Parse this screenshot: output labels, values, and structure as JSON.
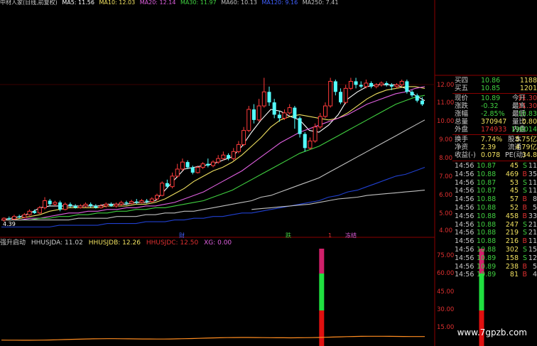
{
  "top_bar": {
    "title": "中材人家(日线,前复权)",
    "ma": [
      {
        "label": "MA5: 11.56",
        "color": "#ffffff"
      },
      {
        "label": "MA10: 12.03",
        "color": "#f0e060"
      },
      {
        "label": "MA20: 12.14",
        "color": "#e060e0"
      },
      {
        "label": "MA30: 11.97",
        "color": "#40d040"
      },
      {
        "label": "MA60: 10.13",
        "color": "#c0c0c0"
      },
      {
        "label": "MA120: 9.16",
        "color": "#4060ff"
      },
      {
        "label": "MA250: 7.41",
        "color": "#c0c0c0"
      }
    ]
  },
  "price_axis": {
    "ticks": [
      "12.00",
      "11.00",
      "10.00",
      "9.00",
      "8.00",
      "7.00",
      "6.00",
      "5.00",
      "4.00"
    ],
    "low_label": "4.39"
  },
  "chart_data": {
    "type": "candlestick",
    "ylim": [
      3.8,
      12.3
    ],
    "candles": [
      [
        4.3,
        4.4,
        4.2,
        4.45
      ],
      [
        4.4,
        4.35,
        4.3,
        4.5
      ],
      [
        4.35,
        4.5,
        4.3,
        4.6
      ],
      [
        4.5,
        4.45,
        4.4,
        4.6
      ],
      [
        4.45,
        4.6,
        4.4,
        4.7
      ],
      [
        4.6,
        4.8,
        4.55,
        4.9
      ],
      [
        4.8,
        4.7,
        4.65,
        4.9
      ],
      [
        4.7,
        5.0,
        4.65,
        5.1
      ],
      [
        5.0,
        5.4,
        4.9,
        5.6
      ],
      [
        5.4,
        5.2,
        5.1,
        5.5
      ],
      [
        5.2,
        5.3,
        5.1,
        5.4
      ],
      [
        5.3,
        4.9,
        4.8,
        5.4
      ],
      [
        4.9,
        5.2,
        4.85,
        5.3
      ],
      [
        5.2,
        5.1,
        5.0,
        5.3
      ],
      [
        5.1,
        5.0,
        4.95,
        5.2
      ],
      [
        5.0,
        5.1,
        4.95,
        5.2
      ],
      [
        5.1,
        5.2,
        5.0,
        5.3
      ],
      [
        5.2,
        5.1,
        5.0,
        5.3
      ],
      [
        5.1,
        5.0,
        4.95,
        5.2
      ],
      [
        5.0,
        5.1,
        4.95,
        5.2
      ],
      [
        5.1,
        5.2,
        5.0,
        5.3
      ],
      [
        5.2,
        5.1,
        5.05,
        5.3
      ],
      [
        5.1,
        5.2,
        5.0,
        5.3
      ],
      [
        5.2,
        5.3,
        5.1,
        5.4
      ],
      [
        5.3,
        5.25,
        5.15,
        5.4
      ],
      [
        5.25,
        5.35,
        5.2,
        5.45
      ],
      [
        5.35,
        5.3,
        5.2,
        5.5
      ],
      [
        5.3,
        5.4,
        5.25,
        5.5
      ],
      [
        5.4,
        5.35,
        5.25,
        5.5
      ],
      [
        5.35,
        5.5,
        5.3,
        5.6
      ],
      [
        5.5,
        5.7,
        5.4,
        5.8
      ],
      [
        5.7,
        6.4,
        5.65,
        6.5
      ],
      [
        6.4,
        6.2,
        6.1,
        6.6
      ],
      [
        6.2,
        6.8,
        6.1,
        7.0
      ],
      [
        6.8,
        7.2,
        6.7,
        7.5
      ],
      [
        7.2,
        7.6,
        7.1,
        7.8
      ],
      [
        7.6,
        7.3,
        7.2,
        7.7
      ],
      [
        7.3,
        7.0,
        6.9,
        7.4
      ],
      [
        7.0,
        7.3,
        6.95,
        7.4
      ],
      [
        7.3,
        7.5,
        7.2,
        7.6
      ],
      [
        7.5,
        7.4,
        7.3,
        7.8
      ],
      [
        7.4,
        7.6,
        7.3,
        7.7
      ],
      [
        7.6,
        7.8,
        7.5,
        8.0
      ],
      [
        7.8,
        8.0,
        7.7,
        8.2
      ],
      [
        8.0,
        7.8,
        7.7,
        8.1
      ],
      [
        7.8,
        8.2,
        7.7,
        8.4
      ],
      [
        8.2,
        8.6,
        8.1,
        8.8
      ],
      [
        8.6,
        9.4,
        8.5,
        9.6
      ],
      [
        9.4,
        10.6,
        9.3,
        10.8
      ],
      [
        10.6,
        10.0,
        9.8,
        10.9
      ],
      [
        10.0,
        10.8,
        9.9,
        11.2
      ],
      [
        10.8,
        11.6,
        10.7,
        12.4
      ],
      [
        11.6,
        11.0,
        10.8,
        11.9
      ],
      [
        11.0,
        10.3,
        10.1,
        11.2
      ],
      [
        10.3,
        10.1,
        9.9,
        10.5
      ],
      [
        10.1,
        10.4,
        10.0,
        10.6
      ],
      [
        10.4,
        10.7,
        10.3,
        10.9
      ],
      [
        10.7,
        10.1,
        9.5,
        10.8
      ],
      [
        10.1,
        9.2,
        9.0,
        10.2
      ],
      [
        9.2,
        8.4,
        8.2,
        9.3
      ],
      [
        8.4,
        8.8,
        8.3,
        9.0
      ],
      [
        8.8,
        9.6,
        8.7,
        9.8
      ],
      [
        9.6,
        10.2,
        9.5,
        10.4
      ],
      [
        10.2,
        10.8,
        10.1,
        11.0
      ],
      [
        10.8,
        12.2,
        10.7,
        12.4
      ],
      [
        12.2,
        11.6,
        11.4,
        12.3
      ],
      [
        11.6,
        11.0,
        10.9,
        11.8
      ],
      [
        11.0,
        11.8,
        10.9,
        12.0
      ],
      [
        11.8,
        12.2,
        11.7,
        12.4
      ],
      [
        12.2,
        12.0,
        11.8,
        12.4
      ],
      [
        12.0,
        11.9,
        11.8,
        12.2
      ],
      [
        11.9,
        12.1,
        11.8,
        12.3
      ],
      [
        12.1,
        11.9,
        11.8,
        12.2
      ],
      [
        11.9,
        12.0,
        11.8,
        12.1
      ],
      [
        12.0,
        12.1,
        11.9,
        12.2
      ],
      [
        12.1,
        12.0,
        11.9,
        12.2
      ],
      [
        12.0,
        11.9,
        11.7,
        12.1
      ],
      [
        11.9,
        12.0,
        11.8,
        12.1
      ],
      [
        12.0,
        12.2,
        11.9,
        12.3
      ],
      [
        12.2,
        11.6,
        11.5,
        12.3
      ],
      [
        11.6,
        11.4,
        11.3,
        11.7
      ],
      [
        11.4,
        11.1,
        11.0,
        11.5
      ],
      [
        11.1,
        10.89,
        10.8,
        11.3
      ]
    ],
    "ma_series": [
      {
        "name": "MA5",
        "color": "#ffffff",
        "values": [
          4.3,
          4.4,
          4.5,
          4.7,
          5.0,
          5.1,
          5.1,
          5.1,
          5.1,
          5.1,
          5.1,
          5.2,
          5.2,
          5.2,
          5.3,
          5.3,
          5.4,
          6.0,
          6.6,
          7.2,
          7.3,
          7.4,
          7.5,
          7.7,
          7.9,
          8.5,
          9.3,
          10.0,
          10.6,
          10.5,
          10.2,
          10.0,
          9.4,
          9.3,
          9.7,
          10.3,
          11.2,
          11.6,
          11.9,
          12.0,
          12.0,
          12.0,
          11.8,
          11.4,
          11.1
        ]
      },
      {
        "name": "MA10",
        "color": "#f0e060",
        "values": [
          4.3,
          4.3,
          4.4,
          4.5,
          4.6,
          4.8,
          4.9,
          5.0,
          5.0,
          5.0,
          5.0,
          5.1,
          5.1,
          5.1,
          5.2,
          5.2,
          5.3,
          5.5,
          5.8,
          6.1,
          6.5,
          6.8,
          7.1,
          7.3,
          7.6,
          8.0,
          8.5,
          9.0,
          9.6,
          10.0,
          10.2,
          10.3,
          10.2,
          10.1,
          10.0,
          10.1,
          10.4,
          10.8,
          11.2,
          11.5,
          11.7,
          11.8,
          11.9,
          11.9,
          11.8
        ]
      },
      {
        "name": "MA20",
        "color": "#e060e0",
        "values": [
          4.3,
          4.3,
          4.3,
          4.4,
          4.4,
          4.5,
          4.6,
          4.7,
          4.7,
          4.8,
          4.8,
          4.9,
          4.9,
          5.0,
          5.0,
          5.1,
          5.1,
          5.2,
          5.3,
          5.5,
          5.7,
          5.9,
          6.2,
          6.5,
          6.8,
          7.1,
          7.5,
          7.9,
          8.3,
          8.7,
          9.0,
          9.3,
          9.5,
          9.7,
          9.9,
          10.1,
          10.3,
          10.6,
          10.9,
          11.1,
          11.3,
          11.5,
          11.6,
          11.8,
          11.9
        ]
      },
      {
        "name": "MA30",
        "color": "#40d040",
        "values": [
          4.3,
          4.3,
          4.3,
          4.3,
          4.4,
          4.4,
          4.5,
          4.5,
          4.6,
          4.6,
          4.7,
          4.7,
          4.8,
          4.8,
          4.9,
          4.9,
          5.0,
          5.0,
          5.1,
          5.2,
          5.3,
          5.4,
          5.6,
          5.8,
          6.0,
          6.3,
          6.6,
          6.9,
          7.2,
          7.5,
          7.8,
          8.1,
          8.3,
          8.5,
          8.8,
          9.1,
          9.4,
          9.7,
          10.0,
          10.3,
          10.6,
          10.9,
          11.1,
          11.3,
          11.4
        ]
      },
      {
        "name": "MA60",
        "color": "#c0c0c0",
        "values": [
          4.3,
          4.3,
          4.3,
          4.3,
          4.3,
          4.3,
          4.3,
          4.3,
          4.4,
          4.4,
          4.4,
          4.4,
          4.5,
          4.5,
          4.5,
          4.6,
          4.6,
          4.7,
          4.7,
          4.8,
          4.8,
          4.9,
          5.0,
          5.1,
          5.2,
          5.3,
          5.4,
          5.6,
          5.7,
          5.9,
          6.1,
          6.3,
          6.5,
          6.7,
          7.0,
          7.3,
          7.6,
          7.9,
          8.2,
          8.5,
          8.8,
          9.1,
          9.4,
          9.7,
          10.0
        ]
      },
      {
        "name": "MA120",
        "color": "#2040d0",
        "values": [
          3.9,
          3.9,
          3.9,
          3.9,
          3.9,
          3.9,
          4.0,
          4.0,
          4.0,
          4.0,
          4.0,
          4.1,
          4.1,
          4.1,
          4.1,
          4.2,
          4.2,
          4.2,
          4.3,
          4.3,
          4.4,
          4.4,
          4.5,
          4.5,
          4.6,
          4.7,
          4.7,
          4.8,
          4.9,
          5.0,
          5.1,
          5.2,
          5.3,
          5.4,
          5.6,
          5.7,
          5.9,
          6.0,
          6.2,
          6.4,
          6.6,
          6.8,
          6.9,
          7.1,
          7.3
        ]
      },
      {
        "name": "MA250",
        "color": "#c0c0c0",
        "values": [
          null,
          null,
          null,
          null,
          null,
          null,
          null,
          null,
          null,
          null,
          null,
          null,
          null,
          null,
          null,
          null,
          null,
          null,
          null,
          null,
          null,
          null,
          null,
          null,
          null,
          null,
          4.9,
          4.95,
          5.0,
          5.05,
          5.1,
          5.15,
          5.2,
          5.3,
          5.4,
          5.5,
          5.55,
          5.6,
          5.7,
          5.75,
          5.8,
          5.85,
          5.9,
          5.95,
          6.0
        ]
      }
    ],
    "signal_bars": {
      "x": [
        34,
        51,
        75,
        107
      ]
    },
    "orange_line_level": 0.13
  },
  "markers": [
    {
      "text": "财",
      "color": "#4060ff"
    },
    {
      "text": "跌",
      "color": "#40d040"
    },
    {
      "text": "1",
      "color": "#e03030"
    },
    {
      "text": "冻结",
      "color": "#e060e0"
    }
  ],
  "indicator": {
    "name": "强升启动",
    "values": [
      {
        "label": "HHUSJDA: 11.02",
        "color": "#cccccc"
      },
      {
        "label": "HHUSJDB: 12.26",
        "color": "#f0e060"
      },
      {
        "label": "HHUSJDC: 12.50",
        "color": "#e03030"
      },
      {
        "label": "XG: 0.00",
        "color": "#e060e0"
      }
    ],
    "axis": [
      "75.00",
      "60.00",
      "45.00",
      "30.00",
      "15.00"
    ]
  },
  "quote_panel": {
    "bids": [
      {
        "label": "买四",
        "price": "10.86",
        "volume": "1188"
      },
      {
        "label": "买五",
        "price": "10.85",
        "volume": "1201"
      }
    ],
    "stats": [
      {
        "l1": "现价",
        "v1": "10.89",
        "c1": "#40d040",
        "l2": "今开",
        "v2": "11.30",
        "c2": "#e03030"
      },
      {
        "l1": "涨跌",
        "v1": "-0.32",
        "c1": "#40d040",
        "l2": "最高",
        "v2": "11.30",
        "c2": "#e03030"
      },
      {
        "l1": "涨幅",
        "v1": "-2.85%",
        "c1": "#40d040",
        "l2": "最低",
        "v2": "10.83",
        "c2": "#40d040"
      },
      {
        "l1": "总量",
        "v1": "370947",
        "c1": "#f0e060",
        "l2": "量比",
        "v2": "0.80",
        "c2": "#f0e060"
      },
      {
        "l1": "外盘",
        "v1": "174933",
        "c1": "#e03030",
        "l2": "内盘",
        "v2": "196014",
        "c2": "#40d040"
      },
      {
        "l1": "换手",
        "v1": "7.74%",
        "c1": "#f0e060",
        "l2": "股本",
        "v2": "5.75亿",
        "c2": "#f0e060"
      },
      {
        "l1": "净资",
        "v1": "2.39",
        "c1": "#f0e060",
        "l2": "流通",
        "v2": "4.79亿",
        "c2": "#f0e060"
      },
      {
        "l1": "收益(-)",
        "v1": "0.078",
        "c1": "#f0e060",
        "l2": "PE(动)",
        "v2": "34.8",
        "c2": "#f0e060"
      }
    ],
    "trades": [
      {
        "time": "14:56",
        "price": "10.87",
        "pc": "#40d040",
        "vol": "45",
        "side": "S",
        "sc": "#40d040",
        "n": "11"
      },
      {
        "time": "14:56",
        "price": "10.88",
        "pc": "#40d040",
        "vol": "469",
        "side": "B",
        "sc": "#e03030",
        "n": "35"
      },
      {
        "time": "14:56",
        "price": "10.87",
        "pc": "#40d040",
        "vol": "53",
        "side": "S",
        "sc": "#40d040",
        "n": "11"
      },
      {
        "time": "14:56",
        "price": "10.87",
        "pc": "#40d040",
        "vol": "45",
        "side": "S",
        "sc": "#40d040",
        "n": "11"
      },
      {
        "time": "14:56",
        "price": "10.88",
        "pc": "#40d040",
        "vol": "57",
        "side": "B",
        "sc": "#e03030",
        "n": "8"
      },
      {
        "time": "14:56",
        "price": "10.88",
        "pc": "#40d040",
        "vol": "52",
        "side": "B",
        "sc": "#e03030",
        "n": "5"
      },
      {
        "time": "14:56",
        "price": "10.88",
        "pc": "#40d040",
        "vol": "458",
        "side": "B",
        "sc": "#e03030",
        "n": "33"
      },
      {
        "time": "14:56",
        "price": "10.88",
        "pc": "#40d040",
        "vol": "247",
        "side": "S",
        "sc": "#40d040",
        "n": "21"
      },
      {
        "time": "14:56",
        "price": "10.88",
        "pc": "#40d040",
        "vol": "219",
        "side": "S",
        "sc": "#40d040",
        "n": "21"
      },
      {
        "time": "14:56",
        "price": "10.88",
        "pc": "#40d040",
        "vol": "216",
        "side": "B",
        "sc": "#e03030",
        "n": "11"
      },
      {
        "time": "14:56",
        "price": "10.88",
        "pc": "#40d040",
        "vol": "302",
        "side": "S",
        "sc": "#40d040",
        "n": "15"
      },
      {
        "time": "14:56",
        "price": "10.89",
        "pc": "#40d040",
        "vol": "158",
        "side": "S",
        "sc": "#40d040",
        "n": "12"
      },
      {
        "time": "14:56",
        "price": "10.89",
        "pc": "#40d040",
        "vol": "238",
        "side": "B",
        "sc": "#e03030",
        "n": "5"
      },
      {
        "time": "14:56",
        "price": "10.89",
        "pc": "#40d040",
        "vol": "81",
        "side": "B",
        "sc": "#e03030",
        "n": "4"
      }
    ]
  },
  "watermark": "www.7gpzb.com"
}
